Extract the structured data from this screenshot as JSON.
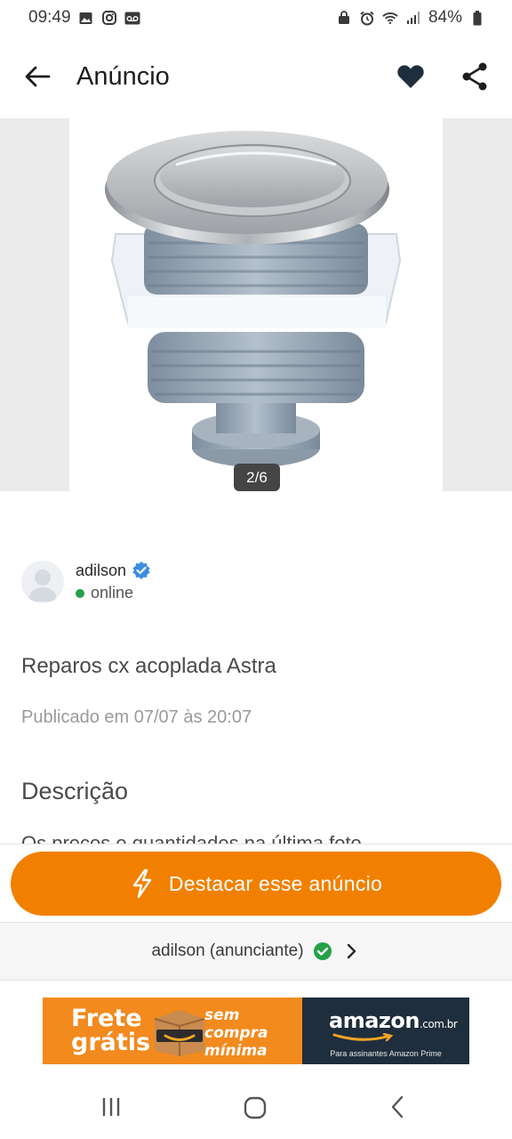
{
  "status_bar": {
    "time": "09:49",
    "battery": "84%",
    "left_icons": [
      "gallery-icon",
      "instagram-icon",
      "voicemail-icon"
    ],
    "right_icons": [
      "lock-icon",
      "alarm-icon",
      "wifi-icon",
      "signal-icon",
      "battery-icon"
    ]
  },
  "app_bar": {
    "title": "Anúncio",
    "back_icon": "arrow-left-icon",
    "favorite_icon": "heart-icon",
    "share_icon": "share-icon"
  },
  "gallery": {
    "counter": "2/6",
    "image": "toilet-push-button-product"
  },
  "seller": {
    "name": "adilson",
    "verified": true,
    "status": "online",
    "status_color": "#24a148"
  },
  "ad": {
    "title": "Reparos cx acoplada Astra",
    "published": "Publicado em 07/07 às 20:07",
    "description_heading": "Descrição",
    "description_preview": "Os preços e quantidades na última foto"
  },
  "actions": {
    "highlight_button": "Destacar esse anúncio",
    "highlight_color": "#f28000"
  },
  "advertiser": {
    "label": "adilson (anunciante)"
  },
  "banner": {
    "left_text_1": "Frete",
    "left_text_2": "grátis",
    "promo_1": "sem",
    "promo_2": "compra",
    "promo_3": "mínima",
    "brand": "amazon",
    "brand_suffix": ".com.br",
    "brand_sub": "Para assinantes Amazon Prime"
  },
  "nav_bar": {
    "icons": [
      "recent-apps-icon",
      "home-icon",
      "back-icon"
    ]
  }
}
